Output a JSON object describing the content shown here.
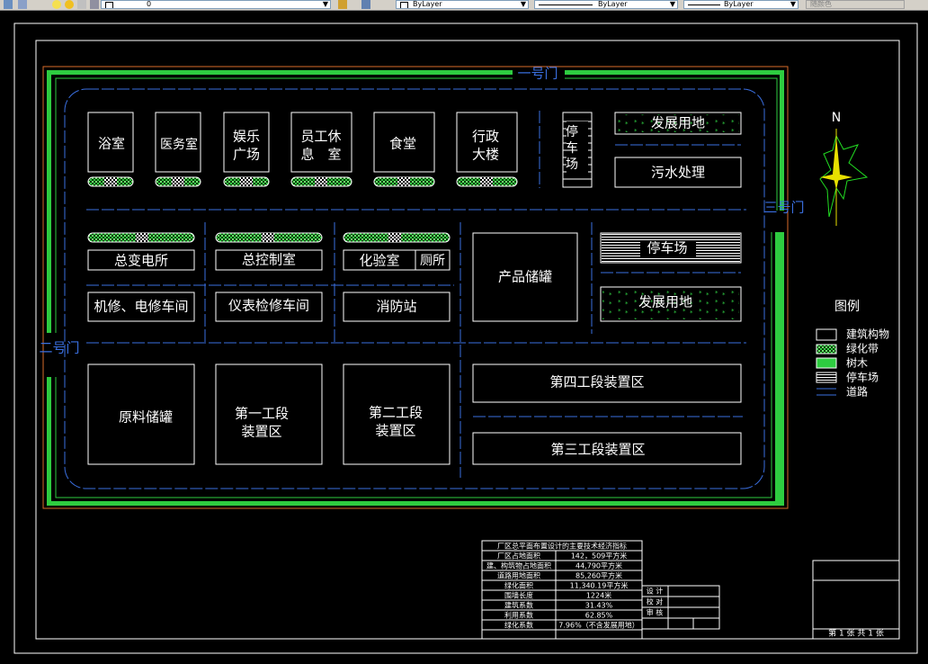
{
  "toolbar": {
    "layer_value": "0",
    "linetype_value": "ByLayer",
    "lineweight_value": "ByLayer",
    "color_value": "ByLayer",
    "plotstyle_value": "随颜色"
  },
  "gates": {
    "gate_1": "一号门",
    "gate_2": "二号门",
    "gate_3": "三号门"
  },
  "buildings": {
    "bath": "浴室",
    "clinic": "医务室",
    "plaza_l1": "娱乐",
    "plaza_l2": "广场",
    "rest_l1": "员工休",
    "rest_l2": "息　室",
    "canteen": "食堂",
    "admin_l1": "行政",
    "admin_l2": "大楼",
    "parking_v1": "停",
    "parking_v2": "车",
    "parking_v3": "场",
    "dev_land_top": "发展用地",
    "sewage": "污水处理",
    "substation": "总变电所",
    "control_room": "总控制室",
    "lab": "化验室",
    "toilet": "厕所",
    "product_tank": "产品储罐",
    "parking_h": "停车场",
    "repair_shop": "机修、电修车间",
    "instrument_shop": "仪表检修车间",
    "fire_station": "消防站",
    "dev_land_mid": "发展用地",
    "raw_tank": "原料储罐",
    "section1_l1": "第一工段",
    "section1_l2": "装置区",
    "section2_l1": "第二工段",
    "section2_l2": "装置区",
    "section4": "第四工段装置区",
    "section3": "第三工段装置区"
  },
  "compass": {
    "north": "N"
  },
  "legend": {
    "title": "图例",
    "items": [
      {
        "label": "建筑构物",
        "type": "building"
      },
      {
        "label": "绿化带",
        "type": "greenbelt"
      },
      {
        "label": "树木",
        "type": "trees"
      },
      {
        "label": "停车场",
        "type": "parking"
      },
      {
        "label": "道路",
        "type": "road"
      }
    ]
  },
  "econ_table": {
    "title": "厂区总平面布置设计的主要技术经济指标",
    "rows": [
      {
        "k": "厂区占地面积",
        "v": "142，509平方米"
      },
      {
        "k": "建、构筑物占地面积",
        "v": "44,790平方米"
      },
      {
        "k": "道路用地面积",
        "v": "85,260平方米"
      },
      {
        "k": "绿化面积",
        "v": "11,340.19平方米"
      },
      {
        "k": "围墙长度",
        "v": "1224米"
      },
      {
        "k": "建筑系数",
        "v": "31.43%"
      },
      {
        "k": "利用系数",
        "v": "62.85%"
      },
      {
        "k": "绿化系数",
        "v": "7.96%（不含发展用地）"
      }
    ]
  },
  "title_block": {
    "design": "设 计",
    "check": "校 对",
    "review": "审 核",
    "sheet": "第 1 张 共 1 张"
  },
  "colors": {
    "background": "#000000",
    "green": "#2ecc40",
    "road_blue": "#3a6fe0",
    "lines": "#ffffff",
    "orange": "#d86c2a",
    "compass_yellow": "#e8e000",
    "compass_green": "#22dd22"
  }
}
